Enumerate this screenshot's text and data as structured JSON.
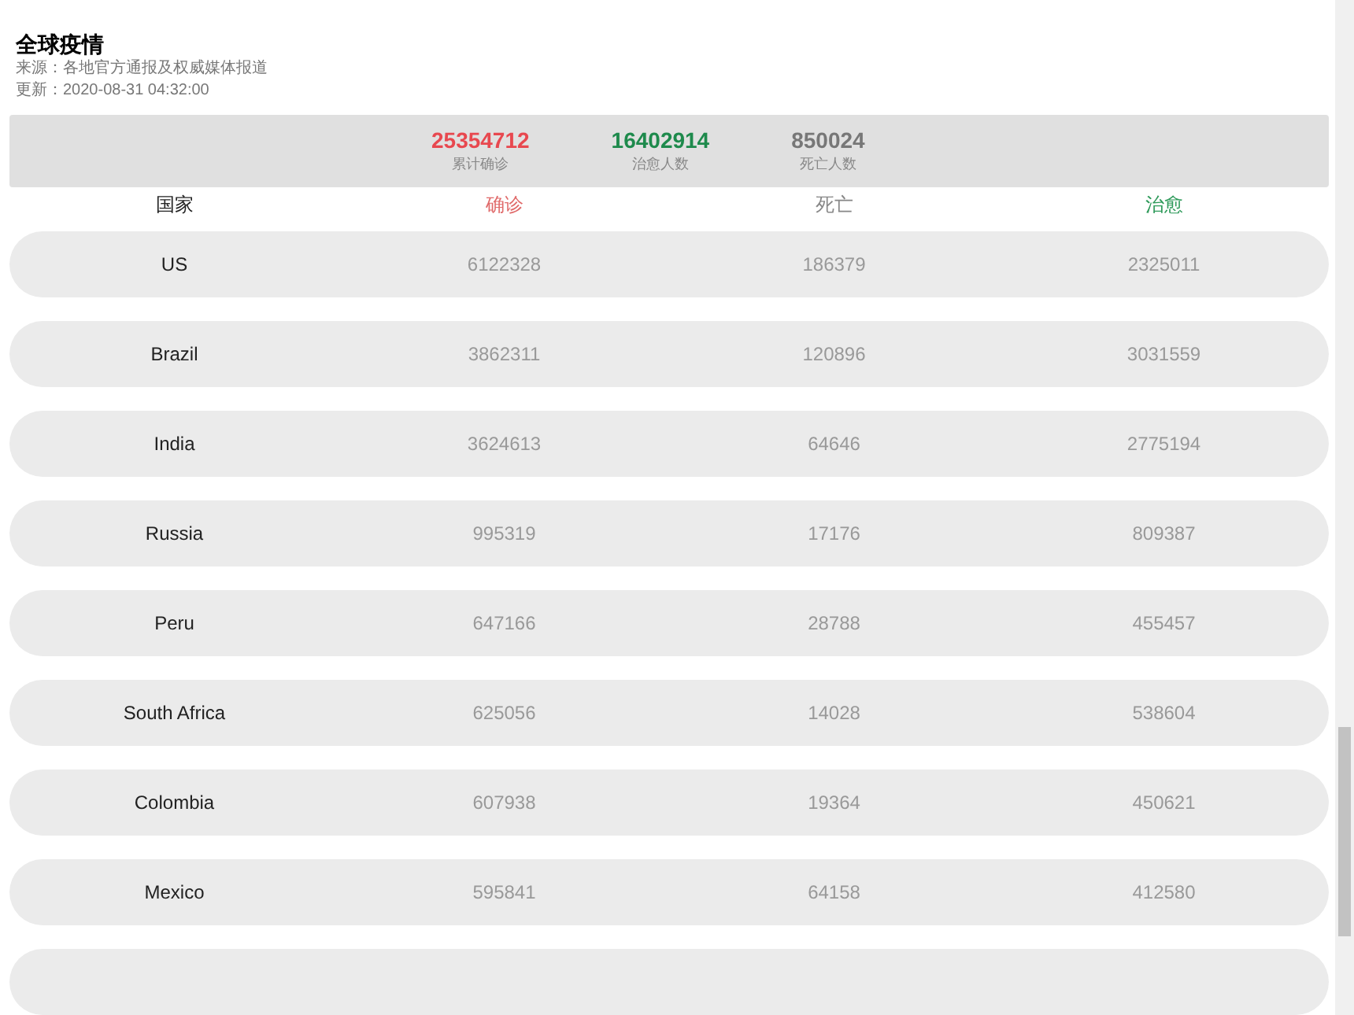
{
  "header": {
    "title": "全球疫情",
    "source": "来源：各地官方通报及权威媒体报道",
    "updated": "更新：2020-08-31 04:32:00"
  },
  "summary": [
    {
      "kind": "confirmed",
      "value": "25354712",
      "label": "累计确诊"
    },
    {
      "kind": "recovered",
      "value": "16402914",
      "label": "治愈人数"
    },
    {
      "kind": "deaths",
      "value": "850024",
      "label": "死亡人数"
    }
  ],
  "table": {
    "columns": [
      {
        "kind": "country",
        "label": "国家"
      },
      {
        "kind": "confirmed",
        "label": "确诊"
      },
      {
        "kind": "deaths",
        "label": "死亡"
      },
      {
        "kind": "recovered",
        "label": "治愈"
      }
    ],
    "rows": [
      [
        "US",
        "6122328",
        "186379",
        "2325011"
      ],
      [
        "Brazil",
        "3862311",
        "120896",
        "3031559"
      ],
      [
        "India",
        "3624613",
        "64646",
        "2775194"
      ],
      [
        "Russia",
        "995319",
        "17176",
        "809387"
      ],
      [
        "Peru",
        "647166",
        "28788",
        "455457"
      ],
      [
        "South Africa",
        "625056",
        "14028",
        "538604"
      ],
      [
        "Colombia",
        "607938",
        "19364",
        "450621"
      ],
      [
        "Mexico",
        "595841",
        "64158",
        "412580"
      ]
    ]
  }
}
